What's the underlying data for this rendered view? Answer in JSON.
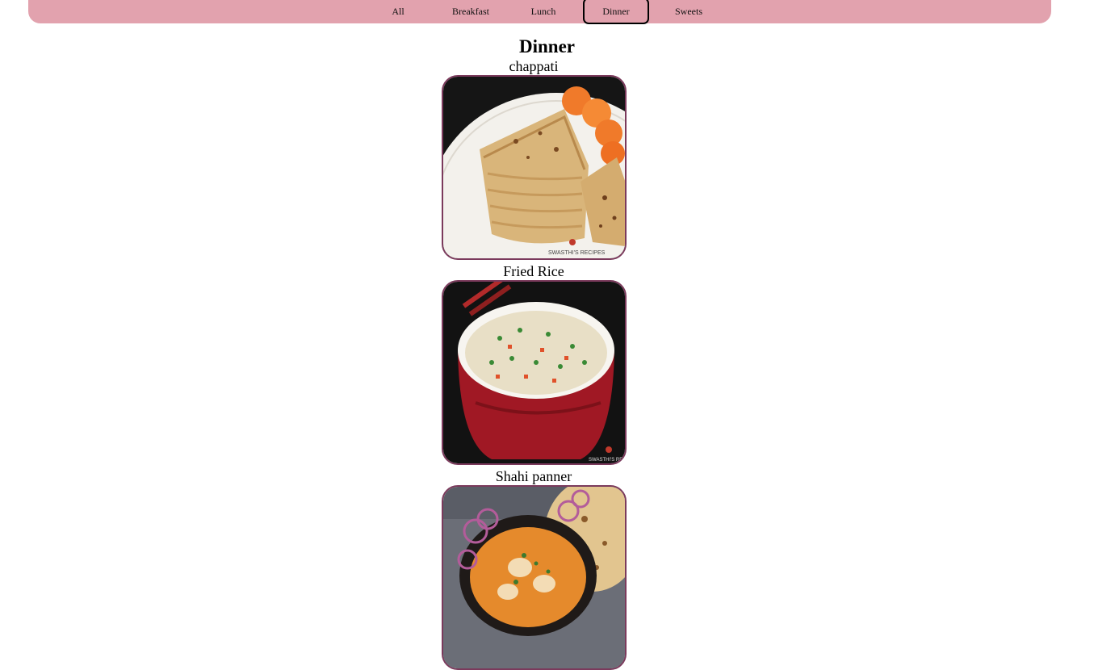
{
  "nav": {
    "items": [
      {
        "label": "All",
        "active": false
      },
      {
        "label": "Breakfast",
        "active": false
      },
      {
        "label": "Lunch",
        "active": false
      },
      {
        "label": "Dinner",
        "active": true
      },
      {
        "label": "Sweets",
        "active": false
      }
    ]
  },
  "section": {
    "title": "Dinner"
  },
  "menu": {
    "items": [
      {
        "name": "chappati",
        "photo": "chappati-photo"
      },
      {
        "name": "Fried Rice",
        "photo": "fried-rice-photo"
      },
      {
        "name": "Shahi panner",
        "photo": "shahi-paneer-photo"
      }
    ]
  },
  "colors": {
    "navbar": "#e2a2ae",
    "image_border": "#7b3a5c"
  }
}
